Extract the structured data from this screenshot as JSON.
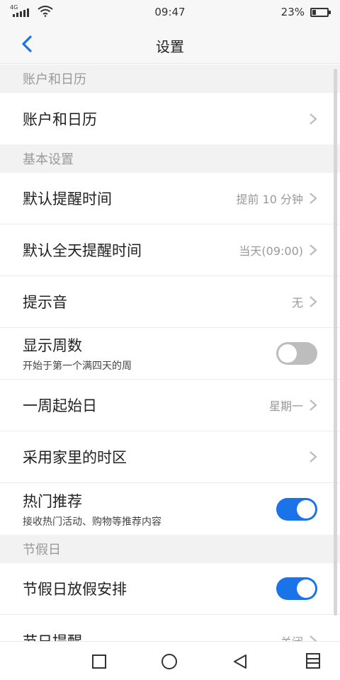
{
  "status_bar": {
    "network": "4G",
    "time": "09:47",
    "battery_text": "23%",
    "battery_level": 0.23
  },
  "header": {
    "title": "设置"
  },
  "sections": [
    {
      "header": "账户和日历",
      "rows": [
        {
          "title": "账户和日历",
          "type": "chevron"
        }
      ]
    },
    {
      "header": "基本设置",
      "rows": [
        {
          "title": "默认提醒时间",
          "value": "提前 10 分钟",
          "type": "chevron"
        },
        {
          "title": "默认全天提醒时间",
          "value": "当天(09:00)",
          "type": "chevron"
        },
        {
          "title": "提示音",
          "value": "无",
          "type": "chevron"
        },
        {
          "title": "显示周数",
          "subtitle": "开始于第一个满四天的周",
          "type": "toggle",
          "on": false
        },
        {
          "title": "一周起始日",
          "value": "星期一",
          "type": "chevron"
        },
        {
          "title": "采用家里的时区",
          "type": "chevron"
        },
        {
          "title": "热门推荐",
          "subtitle": "接收热门活动、购物等推荐内容",
          "type": "toggle",
          "on": true
        }
      ]
    },
    {
      "header": "节假日",
      "rows": [
        {
          "title": "节假日放假安排",
          "type": "toggle",
          "on": true
        },
        {
          "title": "节日提醒",
          "value": "关闭",
          "type": "chevron"
        }
      ]
    }
  ],
  "colors": {
    "accent": "#1a73e8",
    "toggle_off": "#bdbdbd",
    "section_bg": "#f2f2f2",
    "back_icon": "#1a73e8"
  },
  "nav_bar": {
    "buttons": [
      "recent-apps-icon",
      "home-icon",
      "back-triangle-icon",
      "menu-icon"
    ]
  }
}
